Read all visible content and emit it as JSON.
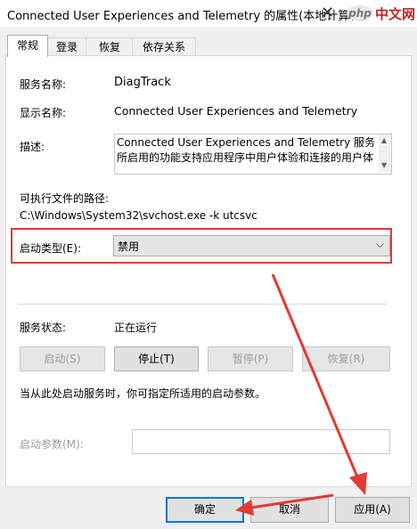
{
  "window": {
    "title": "Connected User Experiences and Telemetry 的属性(本地计算机)",
    "close_glyph": "✕",
    "watermark": {
      "badge": "php",
      "text": "中文网"
    }
  },
  "tabs": [
    {
      "label": "常规",
      "active": true
    },
    {
      "label": "登录",
      "active": false
    },
    {
      "label": "恢复",
      "active": false
    },
    {
      "label": "依存关系",
      "active": false
    }
  ],
  "general": {
    "service_name_label": "服务名称:",
    "service_name_value": "DiagTrack",
    "display_name_label": "显示名称:",
    "display_name_value": "Connected User Experiences and Telemetry",
    "description_label": "描述:",
    "description_value": "Connected User Experiences and Telemetry 服务\n所启用的功能支持应用程序中用户体验和连接的用户体",
    "exe_path_label": "可执行文件的路径:",
    "exe_path_value": "C:\\Windows\\System32\\svchost.exe -k utcsvc",
    "startup_type_label": "启动类型(E):",
    "startup_type_value": "禁用",
    "status_label": "服务状态:",
    "status_value": "正在运行",
    "hint_text": "当从此处启动服务时，你可指定所适用的启动参数。",
    "start_params_label": "启动参数(M):",
    "start_params_value": ""
  },
  "service_buttons": {
    "start": "启动(S)",
    "stop": "停止(T)",
    "pause": "暂停(P)",
    "resume": "恢复(R)"
  },
  "dialog_buttons": {
    "ok": "确定",
    "cancel": "取消",
    "apply": "应用(A)"
  },
  "colors": {
    "highlight_red": "#e53935",
    "focus_blue": "#0078d7"
  },
  "icons": {
    "dropdown": "chevron-down-icon",
    "scroll_up": "scroll-up-icon",
    "scroll_down": "scroll-down-icon"
  }
}
